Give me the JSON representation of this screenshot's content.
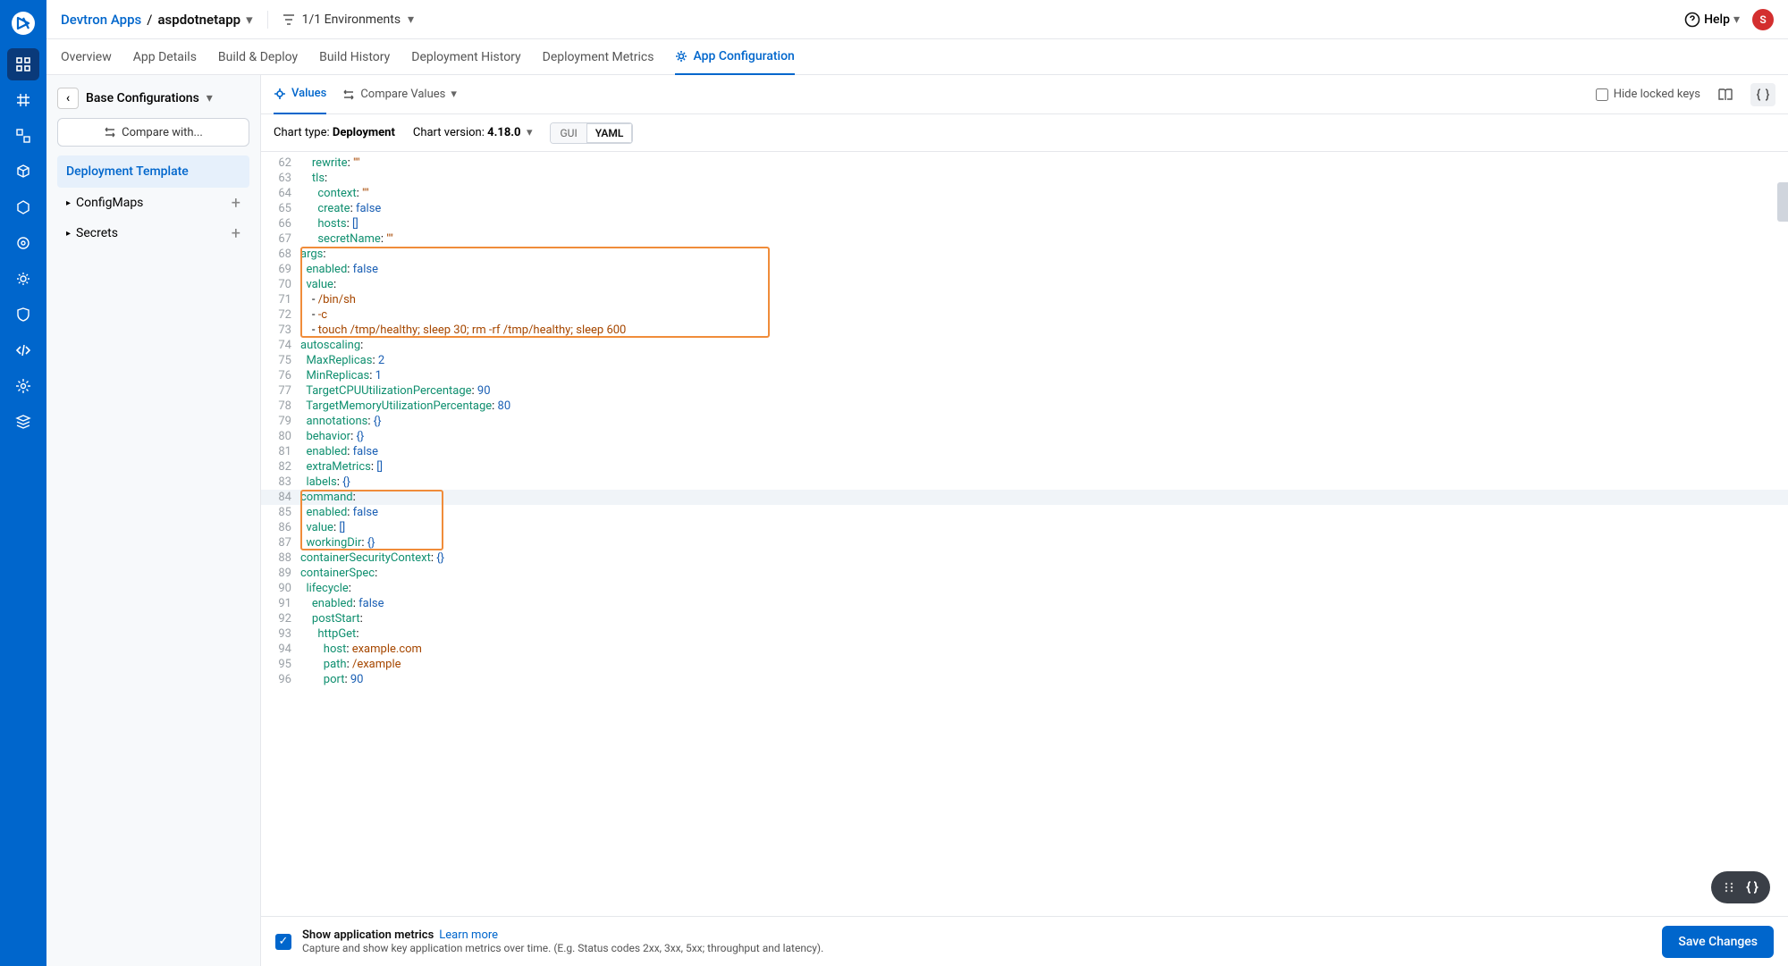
{
  "breadcrumb": {
    "root": "Devtron Apps",
    "sep": "/",
    "app": "aspdotnetapp"
  },
  "env_selector": "1/1 Environments",
  "help": "Help",
  "avatar": "S",
  "page_tabs": [
    "Overview",
    "App Details",
    "Build & Deploy",
    "Build History",
    "Deployment History",
    "Deployment Metrics",
    "App Configuration"
  ],
  "page_tabs_active": 6,
  "side": {
    "back": "Base Configurations",
    "compare": "Compare with...",
    "items": [
      {
        "label": "Deployment Template",
        "type": "item",
        "active": true
      },
      {
        "label": "ConfigMaps",
        "type": "expand"
      },
      {
        "label": "Secrets",
        "type": "expand"
      }
    ]
  },
  "editor": {
    "top_tabs": [
      {
        "label": "Values",
        "active": true
      },
      {
        "label": "Compare Values",
        "active": false
      }
    ],
    "hide_locked": "Hide locked keys",
    "chart_type_label": "Chart type:",
    "chart_type": "Deployment",
    "chart_version_label": "Chart version:",
    "chart_version": "4.18.0",
    "toggle": {
      "a": "GUI",
      "b": "YAML"
    }
  },
  "code": [
    {
      "n": 62,
      "txt": "    rewrite: \"\"",
      "c": [
        [
          "    rewrite",
          0
        ],
        [
          ": ",
          9
        ],
        [
          "\"\"",
          1
        ]
      ]
    },
    {
      "n": 63,
      "txt": "    tls:",
      "c": [
        [
          "    tls",
          0
        ],
        [
          ":",
          9
        ]
      ]
    },
    {
      "n": 64,
      "txt": "      context: \"\"",
      "c": [
        [
          "      context",
          0
        ],
        [
          ": ",
          9
        ],
        [
          "\"\"",
          1
        ]
      ]
    },
    {
      "n": 65,
      "txt": "      create: false",
      "c": [
        [
          "      create",
          0
        ],
        [
          ": ",
          9
        ],
        [
          "false",
          2
        ]
      ]
    },
    {
      "n": 66,
      "txt": "      hosts: []",
      "c": [
        [
          "      hosts",
          0
        ],
        [
          ": ",
          9
        ],
        [
          "[]",
          2
        ]
      ]
    },
    {
      "n": 67,
      "txt": "      secretName: \"\"",
      "c": [
        [
          "      secretName",
          0
        ],
        [
          ": ",
          9
        ],
        [
          "\"\"",
          1
        ]
      ]
    },
    {
      "n": 68,
      "txt": "args:",
      "c": [
        [
          "args",
          0
        ],
        [
          ":",
          9
        ]
      ]
    },
    {
      "n": 69,
      "txt": "  enabled: false",
      "c": [
        [
          "  enabled",
          0
        ],
        [
          ": ",
          9
        ],
        [
          "false",
          2
        ]
      ]
    },
    {
      "n": 70,
      "txt": "  value:",
      "c": [
        [
          "  value",
          0
        ],
        [
          ":",
          9
        ]
      ]
    },
    {
      "n": 71,
      "txt": "    - /bin/sh",
      "c": [
        [
          "    - ",
          9
        ],
        [
          "/bin/sh",
          1
        ]
      ]
    },
    {
      "n": 72,
      "txt": "    - -c",
      "c": [
        [
          "    - ",
          9
        ],
        [
          "-c",
          1
        ]
      ]
    },
    {
      "n": 73,
      "txt": "    - touch /tmp/healthy; sleep 30; rm -rf /tmp/healthy; sleep 600",
      "c": [
        [
          "    - ",
          9
        ],
        [
          "touch /tmp/healthy; sleep 30; rm -rf /tmp/healthy; sleep 600",
          1
        ]
      ]
    },
    {
      "n": 74,
      "txt": "autoscaling:",
      "c": [
        [
          "autoscaling",
          0
        ],
        [
          ":",
          9
        ]
      ]
    },
    {
      "n": 75,
      "txt": "  MaxReplicas: 2",
      "c": [
        [
          "  MaxReplicas",
          0
        ],
        [
          ": ",
          9
        ],
        [
          "2",
          2
        ]
      ]
    },
    {
      "n": 76,
      "txt": "  MinReplicas: 1",
      "c": [
        [
          "  MinReplicas",
          0
        ],
        [
          ": ",
          9
        ],
        [
          "1",
          2
        ]
      ]
    },
    {
      "n": 77,
      "txt": "  TargetCPUUtilizationPercentage: 90",
      "c": [
        [
          "  TargetCPUUtilizationPercentage",
          0
        ],
        [
          ": ",
          9
        ],
        [
          "90",
          2
        ]
      ]
    },
    {
      "n": 78,
      "txt": "  TargetMemoryUtilizationPercentage: 80",
      "c": [
        [
          "  TargetMemoryUtilizationPercentage",
          0
        ],
        [
          ": ",
          9
        ],
        [
          "80",
          2
        ]
      ]
    },
    {
      "n": 79,
      "txt": "  annotations: {}",
      "c": [
        [
          "  annotations",
          0
        ],
        [
          ": ",
          9
        ],
        [
          "{}",
          2
        ]
      ]
    },
    {
      "n": 80,
      "txt": "  behavior: {}",
      "c": [
        [
          "  behavior",
          0
        ],
        [
          ": ",
          9
        ],
        [
          "{}",
          2
        ]
      ]
    },
    {
      "n": 81,
      "txt": "  enabled: false",
      "c": [
        [
          "  enabled",
          0
        ],
        [
          ": ",
          9
        ],
        [
          "false",
          2
        ]
      ]
    },
    {
      "n": 82,
      "txt": "  extraMetrics: []",
      "c": [
        [
          "  extraMetrics",
          0
        ],
        [
          ": ",
          9
        ],
        [
          "[]",
          2
        ]
      ]
    },
    {
      "n": 83,
      "txt": "  labels: {}",
      "c": [
        [
          "  labels",
          0
        ],
        [
          ": ",
          9
        ],
        [
          "{}",
          2
        ]
      ]
    },
    {
      "n": 84,
      "txt": "command:",
      "c": [
        [
          "command",
          0
        ],
        [
          ":",
          9
        ]
      ],
      "cur": true
    },
    {
      "n": 85,
      "txt": "  enabled: false",
      "c": [
        [
          "  enabled",
          0
        ],
        [
          ": ",
          9
        ],
        [
          "false",
          2
        ]
      ]
    },
    {
      "n": 86,
      "txt": "  value: []",
      "c": [
        [
          "  value",
          0
        ],
        [
          ": ",
          9
        ],
        [
          "[]",
          2
        ]
      ]
    },
    {
      "n": 87,
      "txt": "  workingDir: {}",
      "c": [
        [
          "  workingDir",
          0
        ],
        [
          ": ",
          9
        ],
        [
          "{}",
          2
        ]
      ]
    },
    {
      "n": 88,
      "txt": "containerSecurityContext: {}",
      "c": [
        [
          "containerSecurityContext",
          0
        ],
        [
          ": ",
          9
        ],
        [
          "{}",
          2
        ]
      ]
    },
    {
      "n": 89,
      "txt": "containerSpec:",
      "c": [
        [
          "containerSpec",
          0
        ],
        [
          ":",
          9
        ]
      ]
    },
    {
      "n": 90,
      "txt": "  lifecycle:",
      "c": [
        [
          "  lifecycle",
          0
        ],
        [
          ":",
          9
        ]
      ]
    },
    {
      "n": 91,
      "txt": "    enabled: false",
      "c": [
        [
          "    enabled",
          0
        ],
        [
          ": ",
          9
        ],
        [
          "false",
          2
        ]
      ]
    },
    {
      "n": 92,
      "txt": "    postStart:",
      "c": [
        [
          "    postStart",
          0
        ],
        [
          ":",
          9
        ]
      ]
    },
    {
      "n": 93,
      "txt": "      httpGet:",
      "c": [
        [
          "      httpGet",
          0
        ],
        [
          ":",
          9
        ]
      ]
    },
    {
      "n": 94,
      "txt": "        host: example.com",
      "c": [
        [
          "        host",
          0
        ],
        [
          ": ",
          9
        ],
        [
          "example.com",
          1
        ]
      ]
    },
    {
      "n": 95,
      "txt": "        path: /example",
      "c": [
        [
          "        path",
          0
        ],
        [
          ": ",
          9
        ],
        [
          "/example",
          1
        ]
      ]
    },
    {
      "n": 96,
      "txt": "        port: 90",
      "c": [
        [
          "        port",
          0
        ],
        [
          ": ",
          9
        ],
        [
          "90",
          2
        ]
      ]
    }
  ],
  "highlights": [
    {
      "from": 68,
      "to": 73
    },
    {
      "from": 84,
      "to": 87
    }
  ],
  "footer": {
    "title": "Show application metrics",
    "link": "Learn more",
    "sub": "Capture and show key application metrics over time. (E.g. Status codes 2xx, 3xx, 5xx; throughput and latency).",
    "save": "Save Changes"
  }
}
